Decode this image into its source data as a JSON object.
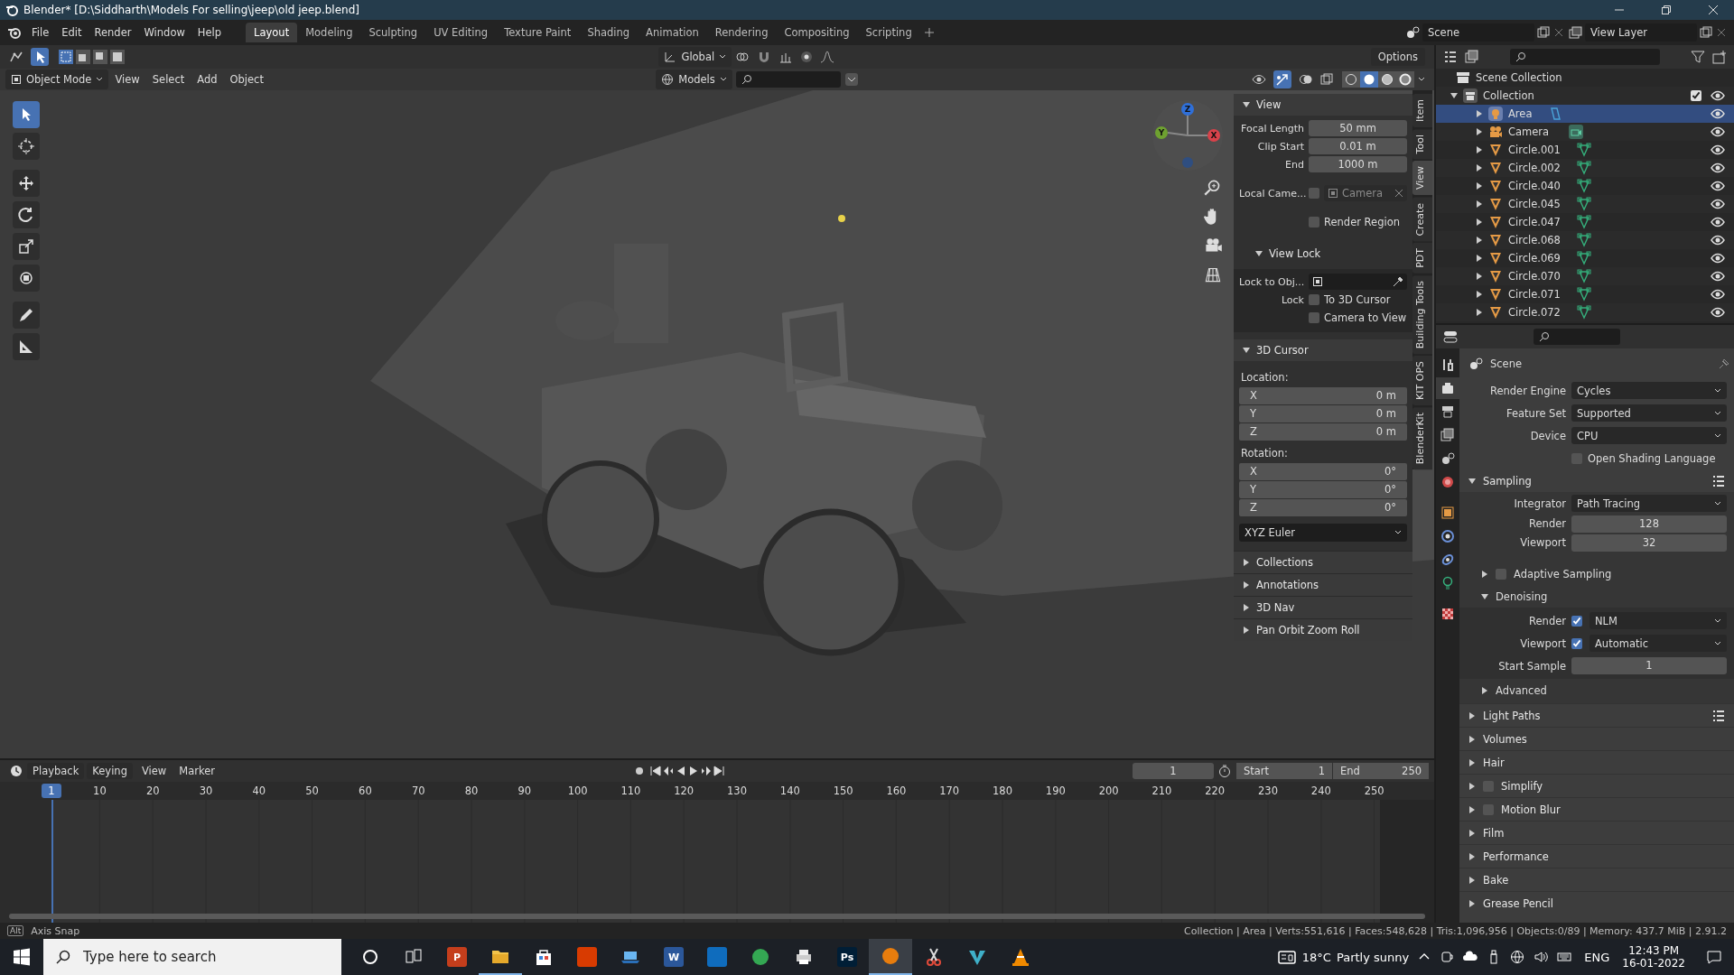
{
  "window": {
    "title": "Blender* [D:\\Siddharth\\Models For selling\\jeep\\old jeep.blend]"
  },
  "menu": [
    "File",
    "Edit",
    "Render",
    "Window",
    "Help"
  ],
  "workspaces": [
    {
      "label": "Layout",
      "selected": true
    },
    {
      "label": "Modeling",
      "selected": false
    },
    {
      "label": "Sculpting",
      "selected": false
    },
    {
      "label": "UV Editing",
      "selected": false
    },
    {
      "label": "Texture Paint",
      "selected": false
    },
    {
      "label": "Shading",
      "selected": false
    },
    {
      "label": "Animation",
      "selected": false
    },
    {
      "label": "Rendering",
      "selected": false
    },
    {
      "label": "Compositing",
      "selected": false
    },
    {
      "label": "Scripting",
      "selected": false
    }
  ],
  "scene": "Scene",
  "view_layer": "View Layer",
  "tool_header": {
    "orientation": "Global",
    "options": "Options"
  },
  "viewport_header": {
    "mode": "Object Mode",
    "menus": [
      "View",
      "Select",
      "Add",
      "Object"
    ],
    "collection": "Models"
  },
  "shading_modes": [
    {
      "kind": "wire",
      "selected": false
    },
    {
      "kind": "solid",
      "selected": true
    },
    {
      "kind": "material",
      "selected": false
    },
    {
      "kind": "rendered",
      "selected": false
    }
  ],
  "tools": [
    {
      "kind": "select",
      "selected": true
    },
    {
      "kind": "cursor",
      "selected": false
    },
    {
      "kind": "move",
      "selected": false
    },
    {
      "kind": "rotate",
      "selected": false
    },
    {
      "kind": "scale",
      "selected": false
    },
    {
      "kind": "transform",
      "selected": false
    },
    {
      "kind": "annotate",
      "selected": false
    },
    {
      "kind": "measure",
      "selected": false
    }
  ],
  "viewport_scene": {
    "kind": "picture"
  },
  "gizmo_axes": [
    {
      "label": "Z",
      "color": "#2f6fd8"
    },
    {
      "label": "Y",
      "color": "#6ea130"
    },
    {
      "label": "X",
      "color": "#d8424a"
    }
  ],
  "sidebar_tabs": [
    {
      "label": "Item",
      "selected": false
    },
    {
      "label": "Tool",
      "selected": false
    },
    {
      "label": "View",
      "selected": true
    },
    {
      "label": "Create",
      "selected": false
    },
    {
      "label": "PDT",
      "selected": false
    },
    {
      "label": "Building Tools",
      "selected": false
    },
    {
      "label": "KIT OPS",
      "selected": false
    },
    {
      "label": "BlenderKit",
      "selected": false
    }
  ],
  "view_panel": {
    "title": "View",
    "fields": [
      {
        "label": "Focal Length",
        "value": "50 mm"
      },
      {
        "label": "Clip Start",
        "value": "0.01 m"
      },
      {
        "label": "End",
        "value": "1000 m"
      }
    ],
    "local_camera": {
      "label": "Local Came...",
      "checked": false,
      "placeholder": "Camera"
    },
    "render_region": {
      "label": "Render Region",
      "checked": false
    },
    "view_lock": {
      "title": "View Lock",
      "lock_to_label": "Lock to Obj...",
      "lock_label": "Lock",
      "options": [
        {
          "label": "To 3D Cursor",
          "checked": false
        },
        {
          "label": "Camera to View",
          "checked": false
        }
      ]
    }
  },
  "cursor_panel": {
    "title": "3D Cursor",
    "location_label": "Location:",
    "location": [
      {
        "axis": "X",
        "value": "0 m"
      },
      {
        "axis": "Y",
        "value": "0 m"
      },
      {
        "axis": "Z",
        "value": "0 m"
      }
    ],
    "rotation_label": "Rotation:",
    "rotation": [
      {
        "axis": "X",
        "value": "0°"
      },
      {
        "axis": "Y",
        "value": "0°"
      },
      {
        "axis": "Z",
        "value": "0°"
      }
    ],
    "mode": "XYZ Euler"
  },
  "collapsed_panels": [
    "Collections",
    "Annotations",
    "3D Nav",
    "Pan Orbit Zoom Roll"
  ],
  "outliner": {
    "root": "Scene Collection",
    "collection": {
      "label": "Collection",
      "checked": true
    },
    "items": [
      {
        "name": "Area",
        "kind": "light",
        "selected": true,
        "visible": true
      },
      {
        "name": "Camera",
        "kind": "camera",
        "selected": false,
        "visible": true
      },
      {
        "name": "Circle.001",
        "kind": "mesh",
        "selected": false,
        "visible": true
      },
      {
        "name": "Circle.002",
        "kind": "mesh",
        "selected": false,
        "visible": true
      },
      {
        "name": "Circle.040",
        "kind": "mesh",
        "selected": false,
        "visible": true
      },
      {
        "name": "Circle.045",
        "kind": "mesh",
        "selected": false,
        "visible": true
      },
      {
        "name": "Circle.047",
        "kind": "mesh",
        "selected": false,
        "visible": true
      },
      {
        "name": "Circle.068",
        "kind": "mesh",
        "selected": false,
        "visible": true
      },
      {
        "name": "Circle.069",
        "kind": "mesh",
        "selected": false,
        "visible": true
      },
      {
        "name": "Circle.070",
        "kind": "mesh",
        "selected": false,
        "visible": true
      },
      {
        "name": "Circle.071",
        "kind": "mesh",
        "selected": false,
        "visible": true
      },
      {
        "name": "Circle.072",
        "kind": "mesh",
        "selected": false,
        "visible": true
      }
    ]
  },
  "property_tabs": [
    {
      "kind": "tool",
      "selected": false
    },
    {
      "kind": "render",
      "selected": true
    },
    {
      "kind": "output",
      "selected": false
    },
    {
      "kind": "view_layer",
      "selected": false
    },
    {
      "kind": "scene",
      "selected": false
    },
    {
      "kind": "world",
      "selected": false
    },
    {
      "kind": "object",
      "selected": false
    },
    {
      "kind": "physics",
      "selected": false
    },
    {
      "kind": "constraints",
      "selected": false
    },
    {
      "kind": "data",
      "selected": false
    },
    {
      "kind": "texture",
      "selected": false
    }
  ],
  "properties": {
    "context": "Scene",
    "rows": [
      {
        "label": "Render Engine",
        "value": "Cycles"
      },
      {
        "label": "Feature Set",
        "value": "Supported"
      },
      {
        "label": "Device",
        "value": "CPU"
      }
    ],
    "osl": {
      "label": "Open Shading Language",
      "checked": false
    },
    "sampling": {
      "title": "Sampling",
      "integrator": {
        "label": "Integrator",
        "value": "Path Tracing"
      },
      "samples": [
        {
          "label": "Render",
          "value": "128"
        },
        {
          "label": "Viewport",
          "value": "32"
        }
      ],
      "adaptive": {
        "label": "Adaptive Sampling",
        "checked": false
      },
      "denoising": {
        "title": "Denoising",
        "rows": [
          {
            "label": "Render",
            "checked": true,
            "value": "NLM"
          },
          {
            "label": "Viewport",
            "checked": true,
            "value": "Automatic"
          }
        ],
        "start_sample": {
          "label": "Start Sample",
          "value": "1"
        }
      },
      "advanced": "Advanced"
    },
    "panels": [
      {
        "label": "Light Paths",
        "kind": "presets"
      },
      {
        "label": "Volumes",
        "kind": "plain"
      },
      {
        "label": "Hair",
        "kind": "plain"
      },
      {
        "label": "Simplify",
        "kind": "checkbox",
        "checked": false
      },
      {
        "label": "Motion Blur",
        "kind": "checkbox",
        "checked": false
      },
      {
        "label": "Film",
        "kind": "plain"
      },
      {
        "label": "Performance",
        "kind": "plain"
      },
      {
        "label": "Bake",
        "kind": "plain"
      },
      {
        "label": "Grease Pencil",
        "kind": "plain"
      }
    ]
  },
  "timeline": {
    "menus": [
      "Playback",
      "Keying",
      "View",
      "Marker"
    ],
    "current_frame": "1",
    "start": {
      "label": "Start",
      "value": "1"
    },
    "end": {
      "label": "End",
      "value": "250"
    },
    "marker": "1",
    "frame_labels": [
      "10",
      "20",
      "30",
      "40",
      "50",
      "60",
      "70",
      "80",
      "90",
      "100",
      "110",
      "120",
      "130",
      "140",
      "150",
      "160",
      "170",
      "180",
      "190",
      "200",
      "210",
      "220",
      "230",
      "240",
      "250"
    ]
  },
  "status_bar": {
    "key": "Alt",
    "hint": "Axis Snap",
    "stats": "Collection | Area | Verts:551,616 | Faces:548,628 | Tris:1,096,956 | Objects:0/89 | Memory: 437.7 MiB | 2.91.2"
  },
  "taskbar": {
    "search_placeholder": "Type here to search",
    "apps": [
      {
        "kind": "cortana",
        "running": false,
        "selected": false
      },
      {
        "kind": "taskview",
        "running": false,
        "selected": false
      },
      {
        "kind": "tile",
        "glyph": "P",
        "color": "#c43e1c",
        "running": false,
        "selected": false
      },
      {
        "kind": "folder",
        "running": true,
        "selected": false
      },
      {
        "kind": "bag",
        "running": false,
        "selected": false
      },
      {
        "kind": "tile",
        "color": "#d83b01",
        "running": false,
        "selected": false
      },
      {
        "kind": "laptop",
        "running": false,
        "selected": false
      },
      {
        "kind": "tile",
        "glyph": "W",
        "color": "#2b579a",
        "running": false,
        "selected": false
      },
      {
        "kind": "tile",
        "color": "#0f6cbd",
        "running": false,
        "selected": false
      },
      {
        "kind": "round",
        "color": "#34a853",
        "running": false,
        "selected": false
      },
      {
        "kind": "printer",
        "running": false,
        "selected": false
      },
      {
        "kind": "tile",
        "glyph": "Ps",
        "color": "#001e36",
        "running": false,
        "selected": false
      },
      {
        "kind": "round",
        "color": "#e87d0d",
        "running": true,
        "selected": true
      },
      {
        "kind": "scissors",
        "running": false,
        "selected": false
      },
      {
        "kind": "vshape",
        "running": false,
        "selected": false
      },
      {
        "kind": "cone",
        "running": false,
        "selected": false
      }
    ],
    "temperature": "18°C",
    "weather": "Partly sunny",
    "language": "ENG",
    "time": "12:43 PM",
    "date": "16-01-2022"
  }
}
